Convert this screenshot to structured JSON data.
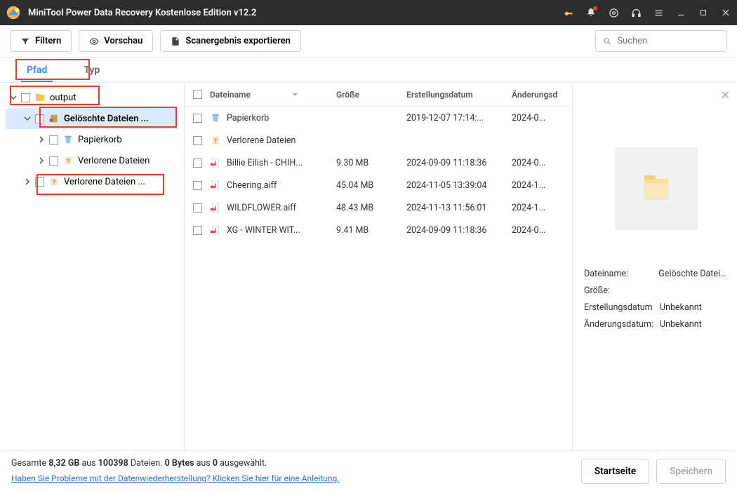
{
  "titlebar": {
    "title": "MiniTool Power Data Recovery Kostenlose Edition v12.2"
  },
  "toolbar": {
    "filter_label": "Filtern",
    "preview_label": "Vorschau",
    "export_label": "Scanergebnis exportieren",
    "search_placeholder": "Suchen"
  },
  "tabs": {
    "path": "Pfad",
    "type": "Typ"
  },
  "tree": {
    "root": "output",
    "deleted_files": "Gelöschte Dateien ...",
    "recycle_bin": "Papierkorb",
    "lost_files_child": "Verlorene Dateien",
    "lost_files_root": "Verlorene Dateien ..."
  },
  "columns": {
    "name": "Dateiname",
    "size": "Größe",
    "created": "Erstellungsdatum",
    "modified": "Änderungsd"
  },
  "files": [
    {
      "name": "Papierkorb",
      "size": "",
      "created": "2019-12-07 17:14:...",
      "modified": "2024-0...",
      "icon": "recycle"
    },
    {
      "name": "Verlorene Dateien",
      "size": "",
      "created": "",
      "modified": "",
      "icon": "unknown"
    },
    {
      "name": "Billie Eilish - CHIH...",
      "size": "9.30 MB",
      "created": "2024-09-09 11:18:36",
      "modified": "2024-0...",
      "icon": "audio"
    },
    {
      "name": "Cheering.aiff",
      "size": "45.04 MB",
      "created": "2024-11-05 13:39:04",
      "modified": "2024-1...",
      "icon": "audio"
    },
    {
      "name": "WILDFLOWER.aiff",
      "size": "48.43 MB",
      "created": "2024-11-13 11:56:01",
      "modified": "2024-1...",
      "icon": "audio"
    },
    {
      "name": "XG - WINTER WIT...",
      "size": "9.41 MB",
      "created": "2024-09-09 11:18:36",
      "modified": "2024-0...",
      "icon": "audio"
    }
  ],
  "preview": {
    "name_label": "Dateiname:",
    "name_value": "Gelöschte Dateien",
    "size_label": "Größe:",
    "size_value": "",
    "created_label": "Erstellungsdatum",
    "created_value": "Unbekannt",
    "modified_label": "Änderungsdatum:",
    "modified_value": "Unbekannt"
  },
  "footer": {
    "total_prefix": "Gesamte ",
    "total_size": "8,32 GB",
    "total_mid": " aus ",
    "total_count": "100398",
    "total_suffix": " Dateien.  ",
    "sel_size": "0 Bytes",
    "sel_mid": " aus ",
    "sel_count": "0",
    "sel_suffix": " ausgewählt.",
    "help_link": "Haben Sie Probleme mit der Datenwiederherstellung? Klicken Sie hier für eine Anleitung.",
    "home": "Startseite",
    "save": "Speichern"
  }
}
